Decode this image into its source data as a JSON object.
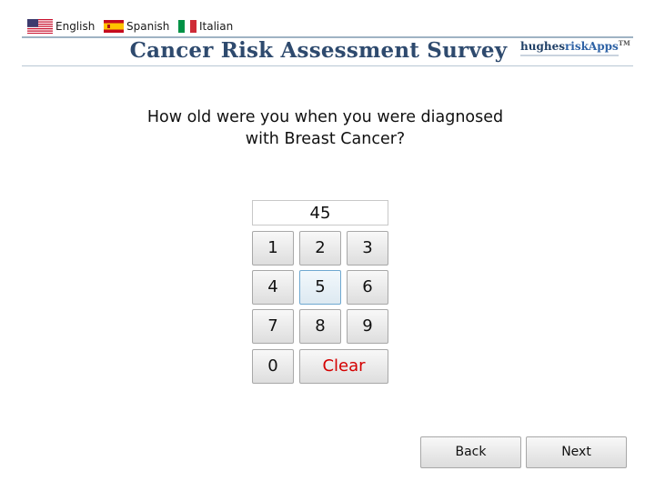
{
  "languages": [
    {
      "label": "English",
      "flag": "us-flag-icon"
    },
    {
      "label": "Spanish",
      "flag": "spain-flag-icon"
    },
    {
      "label": "Italian",
      "flag": "italy-flag-icon"
    }
  ],
  "header": {
    "title": "Cancer Risk Assessment Survey",
    "brand_part1": "hughes",
    "brand_part2": "riskApps",
    "brand_tm": "TM"
  },
  "question": {
    "line1": "How old were you when you were diagnosed",
    "line2": "with Breast Cancer?"
  },
  "keypad": {
    "value": "45",
    "keys": [
      "1",
      "2",
      "3",
      "4",
      "5",
      "6",
      "7",
      "8",
      "9",
      "0"
    ],
    "clear_label": "Clear",
    "focused_key": "5"
  },
  "nav": {
    "back_label": "Back",
    "next_label": "Next"
  },
  "colors": {
    "title": "#2e4a6e",
    "clear": "#d40000",
    "focus_border": "#6fa8d0"
  }
}
